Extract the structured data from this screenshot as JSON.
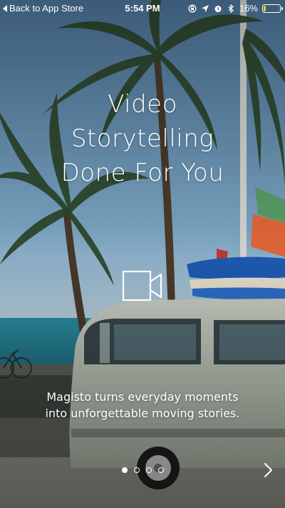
{
  "status_bar": {
    "back_label": "Back to App Store",
    "time": "5:54 PM",
    "battery_percent_label": "16%",
    "battery_level": 0.16,
    "battery_color": "#f5c518",
    "icons": [
      "screen-rotation-lock-icon",
      "location-arrow-icon",
      "alarm-icon",
      "bluetooth-icon"
    ]
  },
  "onboarding": {
    "headline_lines": [
      "Video",
      "Storytelling",
      "Done For You"
    ],
    "tagline_lines": [
      "Magisto turns everyday moments",
      "into unforgettable moving stories."
    ],
    "pager": {
      "total": 4,
      "current": 1
    },
    "next_icon": "chevron-right-icon",
    "feature_icon": "video-camera-icon"
  },
  "colors": {
    "text": "#ffffff",
    "sky": "#6e9dbf",
    "sea": "#2f8fa0"
  }
}
